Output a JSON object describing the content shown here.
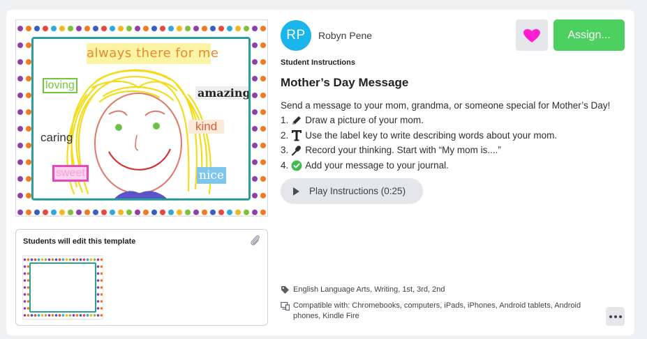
{
  "author": {
    "initials": "RP",
    "name": "Robyn Pene",
    "avatar_color": "#1ab5ea"
  },
  "actions": {
    "favorite_icon": "heart-icon",
    "favorite_color": "#ff1fd0",
    "assign_label": "Assign...",
    "assign_color": "#4cd160"
  },
  "preview": {
    "words": {
      "always": "always there for me",
      "loving": "loving",
      "amazing": "amazing",
      "kind": "kind",
      "caring": "caring",
      "sweet": "sweet",
      "nice": "nice"
    }
  },
  "template": {
    "title": "Students will edit this template",
    "icon": "paperclip-icon"
  },
  "instructions": {
    "label": "Student Instructions",
    "title": "Mother’s Day Message",
    "description": "Send a message to your mom, grandma, or someone special for Mother’s Day!",
    "steps": [
      {
        "num": "1.",
        "icon": "pencil-icon",
        "text": "Draw a picture of your mom."
      },
      {
        "num": "2.",
        "icon": "text-tool-icon",
        "text": "Use the label key to write describing words about your mom."
      },
      {
        "num": "3.",
        "icon": "microphone-icon",
        "text": "Record your thinking. Start with “My mom is....”"
      },
      {
        "num": "4.",
        "icon": "check-circle-icon",
        "text": "Add your message to your journal."
      }
    ],
    "play_label": "Play Instructions (0:25)"
  },
  "meta": {
    "tags": "English Language Arts, Writing, 1st, 3rd, 2nd",
    "compatible": "Compatible with: Chromebooks, computers, iPads, iPhones, Android tablets, Android phones, Kindle Fire"
  }
}
